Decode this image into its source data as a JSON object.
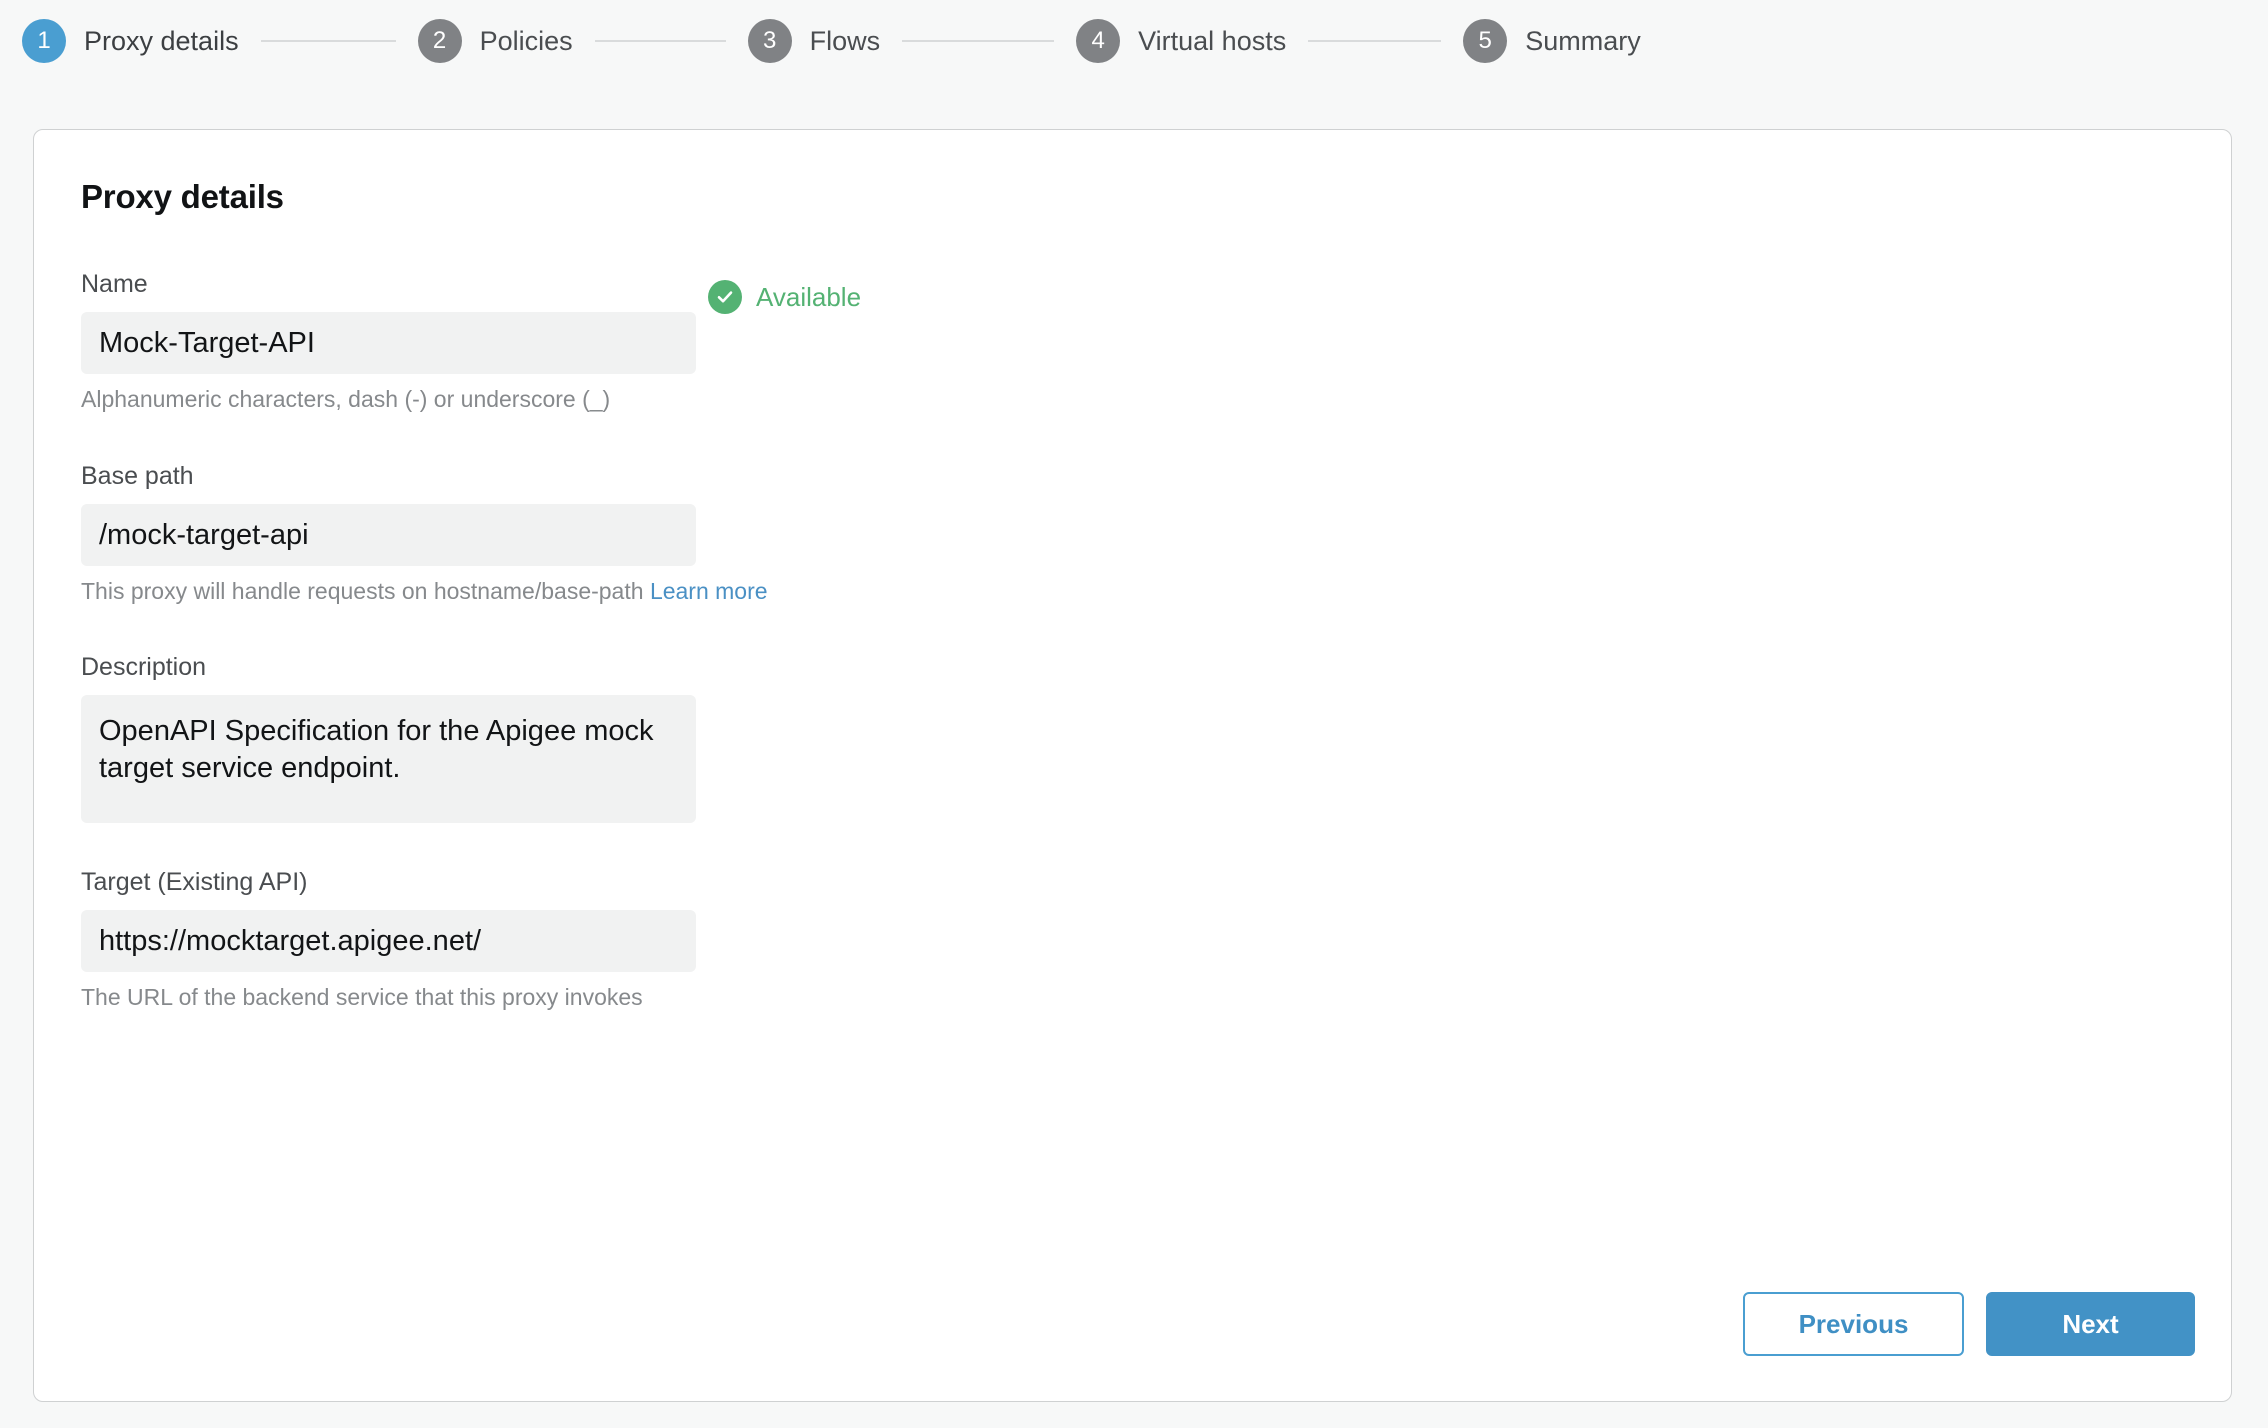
{
  "stepper": {
    "steps": [
      {
        "number": "1",
        "label": "Proxy details",
        "state": "active"
      },
      {
        "number": "2",
        "label": "Policies",
        "state": "inactive"
      },
      {
        "number": "3",
        "label": "Flows",
        "state": "inactive"
      },
      {
        "number": "4",
        "label": "Virtual hosts",
        "state": "inactive"
      },
      {
        "number": "5",
        "label": "Summary",
        "state": "inactive"
      }
    ]
  },
  "card": {
    "title": "Proxy details",
    "fields": {
      "name": {
        "label": "Name",
        "value": "Mock-Target-API",
        "hint": "Alphanumeric characters, dash (-) or underscore (_)"
      },
      "base_path": {
        "label": "Base path",
        "value": "/mock-target-api",
        "hint": "This proxy will handle requests on hostname/base-path",
        "link_text": "Learn more"
      },
      "description": {
        "label": "Description",
        "value": "OpenAPI Specification for the Apigee mock target service endpoint."
      },
      "target": {
        "label": "Target (Existing API)",
        "value": "https://mocktarget.apigee.net/",
        "hint": "The URL of the backend service that this proxy invokes"
      }
    },
    "availability": {
      "icon": "check-circle-icon",
      "text": "Available"
    }
  },
  "footer": {
    "previous_label": "Previous",
    "next_label": "Next"
  },
  "colors": {
    "accent_blue": "#4292c6",
    "step_active": "#4a9ed1",
    "step_inactive": "#808285",
    "success_green": "#54b273",
    "link_blue": "#4a90c4",
    "page_background": "#f7f8f8",
    "input_background": "#f1f2f2"
  }
}
